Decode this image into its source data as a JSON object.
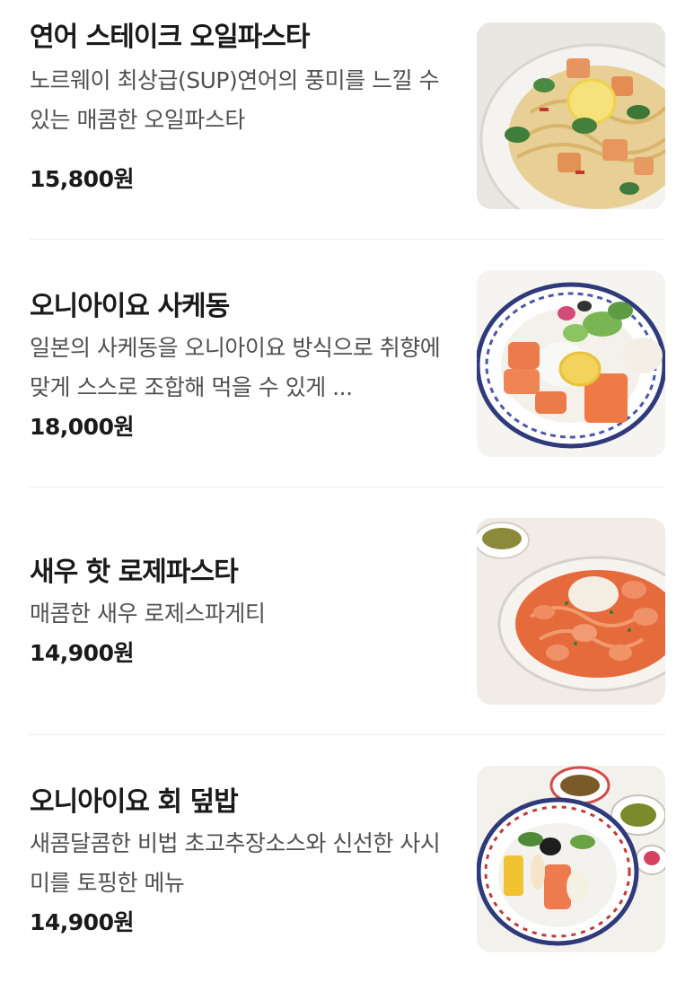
{
  "menu": {
    "items": [
      {
        "name": "연어 스테이크 오일파스타",
        "description": "노르웨이 최상급(SUP)연어의 풍미를 느낄 수 있는 매콤한 오일파스타",
        "price": "15,800원",
        "image": "salmon-steak-oil-pasta-photo"
      },
      {
        "name": "오니아이요 사케동",
        "description": "일본의 사케동을 오니아이요 방식으로 취향에 맞게 스스로 조합해 먹을 수 있게 ...",
        "price": "18,000원",
        "image": "salmon-rice-bowl-photo"
      },
      {
        "name": "새우 핫 로제파스타",
        "description": "매콤한 새우 로제스파게티",
        "price": "14,900원",
        "image": "shrimp-rose-pasta-photo"
      },
      {
        "name": "오니아이요 회 덮밥",
        "description": "새콤달콤한 비법 초고추장소스와 신선한 사시미를 토핑한 메뉴",
        "price": "14,900원",
        "image": "sashimi-rice-bowl-photo"
      }
    ]
  },
  "colors": {
    "title": "#1a1a1a",
    "description": "#505050",
    "divider": "#ececec",
    "background": "#ffffff"
  }
}
